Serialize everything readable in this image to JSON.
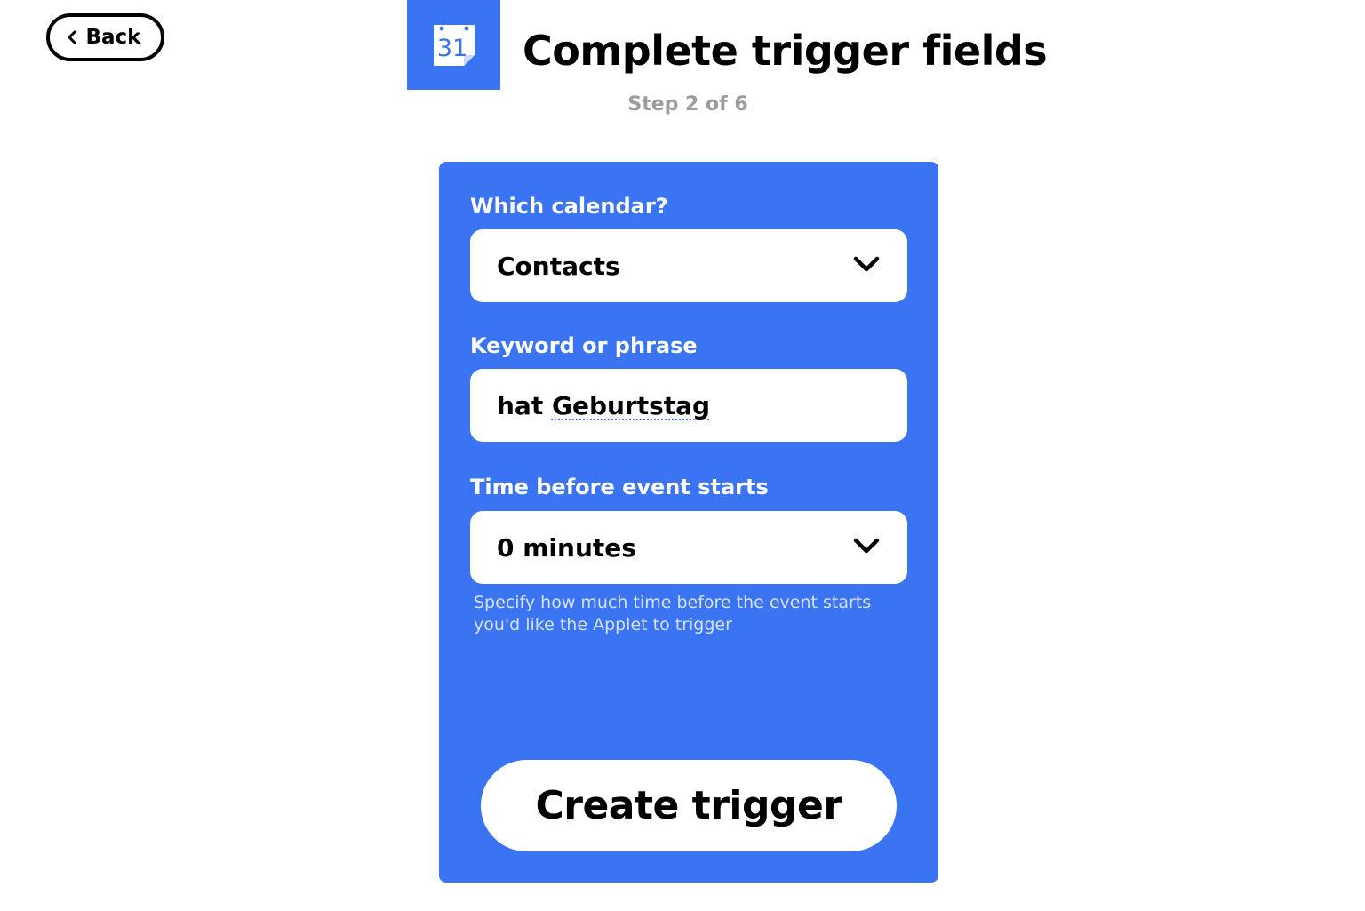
{
  "header": {
    "back_label": "Back",
    "title": "Complete trigger fields",
    "step": "Step 2 of 6",
    "service_icon_text": "31"
  },
  "form": {
    "calendar": {
      "label": "Which calendar?",
      "value": "Contacts"
    },
    "keyword": {
      "label": "Keyword or phrase",
      "value_prefix": "hat ",
      "value_underlined": "Geburtstag"
    },
    "offset": {
      "label": "Time before event starts",
      "value": "0 minutes",
      "helper": "Specify how much time before the event starts you'd like the Applet to trigger"
    },
    "submit_label": "Create trigger"
  },
  "colors": {
    "brand_blue": "#3a74f2",
    "helper_text": "#d6e2fc",
    "step_gray": "#9b9b9b"
  }
}
